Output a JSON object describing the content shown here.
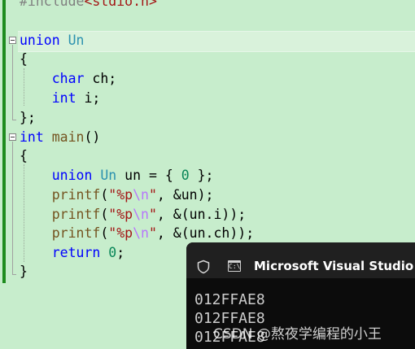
{
  "editor": {
    "line0": {
      "pp": "#include",
      "hdr": "<stdio.h>"
    },
    "line2": {
      "kw": "union",
      "name": "Un"
    },
    "line3": "{",
    "line4": {
      "kw": "char",
      "rest": " ch;"
    },
    "line5": {
      "kw": "int",
      "rest": " i;"
    },
    "line6": "};",
    "line7": {
      "kw": "int",
      "fn": "main",
      "rest": "()"
    },
    "line8": "{",
    "line9": {
      "kw": "union",
      "ty": "Un",
      "rest": " un = { ",
      "num": "0",
      "tail": " };"
    },
    "line10": {
      "fn": "printf",
      "open": "(",
      "str1": "\"%p",
      "esc": "\\n",
      "str2": "\"",
      "rest": ", &un);"
    },
    "line11": {
      "fn": "printf",
      "open": "(",
      "str1": "\"%p",
      "esc": "\\n",
      "str2": "\"",
      "rest": ", &(un.i));"
    },
    "line12": {
      "fn": "printf",
      "open": "(",
      "str1": "\"%p",
      "esc": "\\n",
      "str2": "\"",
      "rest": ", &(un.ch));"
    },
    "line13": {
      "kw": "return",
      "num": "0",
      "rest": ";"
    },
    "line14": "}"
  },
  "console": {
    "title": "Microsoft Visual Studio 调试控制台",
    "app_icon_text": "C:\\",
    "output": [
      "012FFAE8",
      "012FFAE8",
      "012FFAE8"
    ]
  },
  "watermark": "CSDN @熬夜学编程的小王",
  "colors": {
    "editor_bg": "#c7edcc",
    "keyword": "#0000ff",
    "type": "#2b91af",
    "function": "#74531f",
    "string": "#a31515",
    "escape": "#b776fb",
    "console_bg": "#0c0c0c"
  },
  "icons": [
    "shield-icon",
    "console-app-icon",
    "fold-collapse-icon"
  ]
}
